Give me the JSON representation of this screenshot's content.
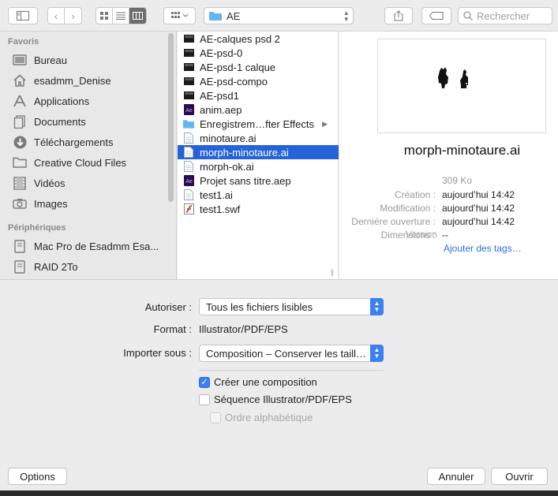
{
  "toolbar": {
    "path_folder": "AE",
    "search_placeholder": "Rechercher"
  },
  "sidebar": {
    "favorites_heading": "Favoris",
    "favorites": [
      {
        "label": "Bureau",
        "icon": "desktop-icon"
      },
      {
        "label": "esadmm_Denise",
        "icon": "home-icon"
      },
      {
        "label": "Applications",
        "icon": "applications-icon"
      },
      {
        "label": "Documents",
        "icon": "documents-icon"
      },
      {
        "label": "Téléchargements",
        "icon": "downloads-icon"
      },
      {
        "label": "Creative Cloud Files",
        "icon": "folder-icon"
      },
      {
        "label": "Vidéos",
        "icon": "film-icon"
      },
      {
        "label": "Images",
        "icon": "camera-icon"
      }
    ],
    "devices_heading": "Périphériques",
    "devices": [
      {
        "label": "Mac Pro de Esadmm Esa...",
        "icon": "computer-icon"
      },
      {
        "label": "RAID 2To",
        "icon": "drive-icon"
      }
    ]
  },
  "files": [
    {
      "name": "AE-calques psd 2",
      "icon": "psd-file-icon"
    },
    {
      "name": "AE-psd-0",
      "icon": "psd-file-icon"
    },
    {
      "name": "AE-psd-1 calque",
      "icon": "psd-file-icon"
    },
    {
      "name": "AE-psd-compo",
      "icon": "psd-file-icon"
    },
    {
      "name": "AE-psd1",
      "icon": "psd-file-icon"
    },
    {
      "name": "anim.aep",
      "icon": "aep-file-icon"
    },
    {
      "name": "Enregistrem…fter Effects",
      "icon": "folder-icon"
    },
    {
      "name": "minotaure.ai",
      "icon": "ai-file-icon"
    },
    {
      "name": "morph-minotaure.ai",
      "icon": "ai-file-icon"
    },
    {
      "name": "morph-ok.ai",
      "icon": "ai-file-icon"
    },
    {
      "name": "Projet sans titre.aep",
      "icon": "aep-file-icon"
    },
    {
      "name": "test1.ai",
      "icon": "ai-file-icon"
    },
    {
      "name": "test1.swf",
      "icon": "swf-file-icon"
    }
  ],
  "selected_file_index": 8,
  "preview": {
    "filename": "morph-minotaure.ai",
    "size": "309 Ko",
    "meta": [
      {
        "key": "Création :",
        "value": "aujourd’hui 14:42"
      },
      {
        "key": "Modification :",
        "value": "aujourd’hui 14:42"
      },
      {
        "key": "Dernière ouverture :",
        "value": "aujourd’hui 14:42"
      },
      {
        "key": "Dimensions :",
        "value": "--"
      }
    ],
    "version_label": "Version",
    "tags_link": "Ajouter des tags…"
  },
  "options": {
    "allow_label": "Autoriser :",
    "allow_value": "Tous les fichiers lisibles",
    "format_label": "Format :",
    "format_value": "Illustrator/PDF/EPS",
    "import_label": "Importer sous :",
    "import_value": "Composition – Conserver les taill…",
    "create_comp": {
      "label": "Créer une composition",
      "checked": true
    },
    "sequence": {
      "label": "Séquence Illustrator/PDF/EPS",
      "checked": false
    },
    "alpha_order": {
      "label": "Ordre alphabétique",
      "checked": false,
      "disabled": true
    }
  },
  "buttons": {
    "options": "Options",
    "cancel": "Annuler",
    "open": "Ouvrir"
  },
  "colors": {
    "accent": "#3b7ff0",
    "selection": "#2463d9"
  }
}
